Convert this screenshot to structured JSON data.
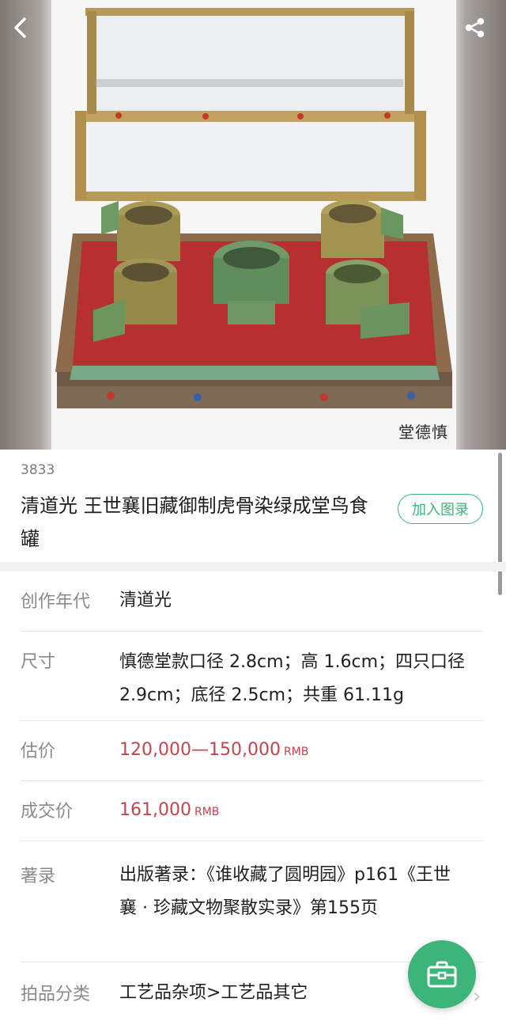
{
  "hero": {
    "seal_text": "堂德慎"
  },
  "lot": {
    "number": "3833",
    "title": "清道光 王世襄旧藏御制虎骨染绿成堂鸟食罐",
    "add_catalog_label": "加入图录"
  },
  "details": [
    {
      "label": "创作年代",
      "value": "清道光"
    },
    {
      "label": "尺寸",
      "value": "慎德堂款口径 2.8cm；高 1.6cm；四只口径 2.9cm；底径 2.5cm；共重 61.11g"
    },
    {
      "label": "估价",
      "value": "120,000—150,000",
      "unit": "RMB"
    },
    {
      "label": "成交价",
      "value": "161,000",
      "unit": "RMB"
    },
    {
      "label": "著录",
      "value": "出版著录：《谁收藏了圆明园》p161《王世襄 · 珍藏文物聚散实录》第155页"
    },
    {
      "label": "拍品分类",
      "value": "工艺品杂项>工艺品其它"
    }
  ],
  "icons": {
    "back": "chevron-left-icon",
    "share": "share-icon",
    "fab": "briefcase-icon",
    "row_arrow": "chevron-right-icon"
  },
  "colors": {
    "accent_green": "#3db57a",
    "price_red": "#c0454f",
    "label_gray": "#8a8a8a"
  }
}
